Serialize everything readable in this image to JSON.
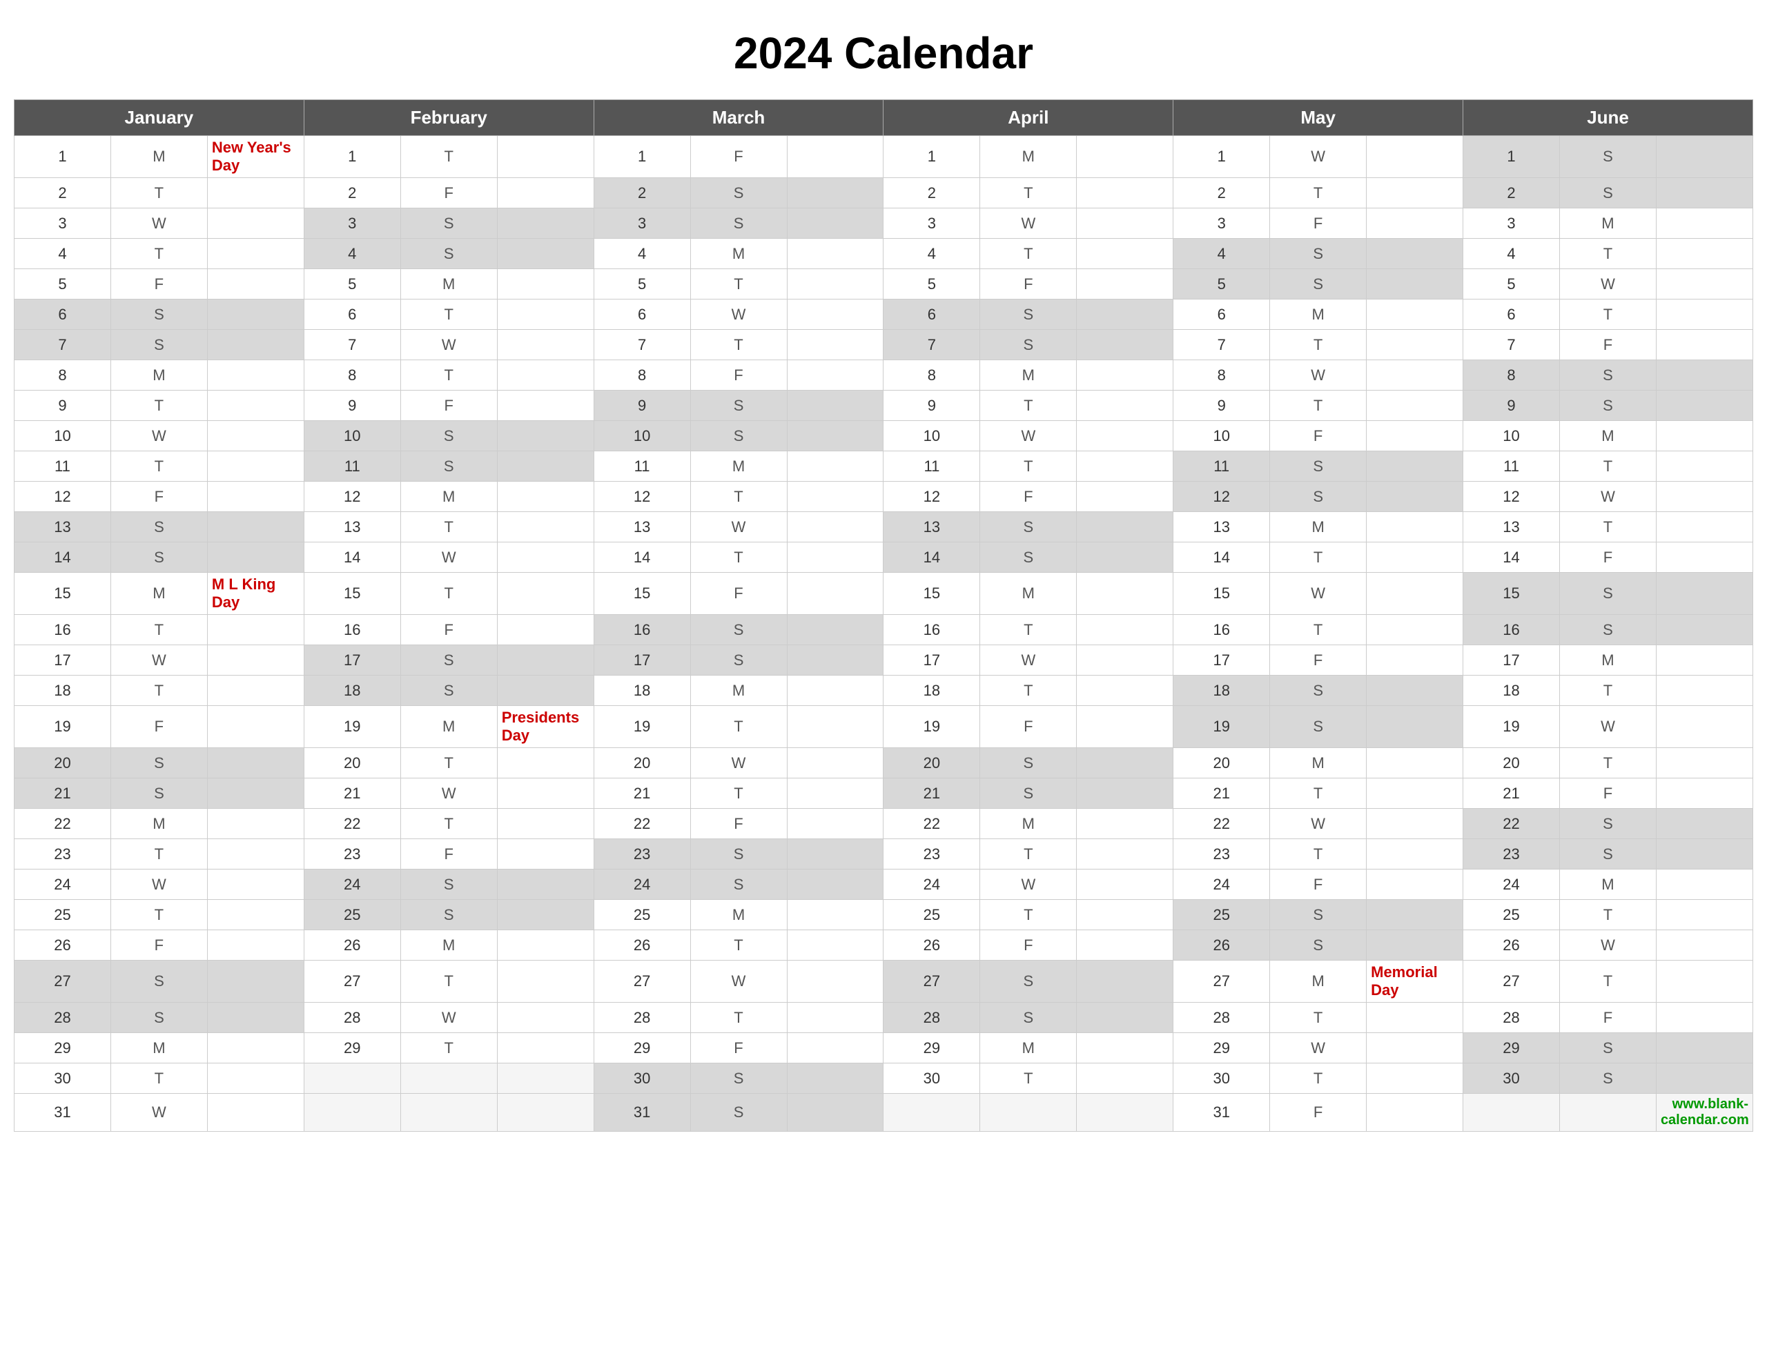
{
  "title": "2024 Calendar",
  "months": [
    "January",
    "February",
    "March",
    "April",
    "May",
    "June"
  ],
  "days": {
    "jan": [
      {
        "d": 1,
        "day": "M",
        "event": "New Year's Day",
        "weekend": false
      },
      {
        "d": 2,
        "day": "T",
        "event": "",
        "weekend": false
      },
      {
        "d": 3,
        "day": "W",
        "event": "",
        "weekend": false
      },
      {
        "d": 4,
        "day": "T",
        "event": "",
        "weekend": false
      },
      {
        "d": 5,
        "day": "F",
        "event": "",
        "weekend": false
      },
      {
        "d": 6,
        "day": "S",
        "event": "",
        "weekend": true
      },
      {
        "d": 7,
        "day": "S",
        "event": "",
        "weekend": true
      },
      {
        "d": 8,
        "day": "M",
        "event": "",
        "weekend": false
      },
      {
        "d": 9,
        "day": "T",
        "event": "",
        "weekend": false
      },
      {
        "d": 10,
        "day": "W",
        "event": "",
        "weekend": false
      },
      {
        "d": 11,
        "day": "T",
        "event": "",
        "weekend": false
      },
      {
        "d": 12,
        "day": "F",
        "event": "",
        "weekend": false
      },
      {
        "d": 13,
        "day": "S",
        "event": "",
        "weekend": true
      },
      {
        "d": 14,
        "day": "S",
        "event": "",
        "weekend": true
      },
      {
        "d": 15,
        "day": "M",
        "event": "M L King Day",
        "weekend": false
      },
      {
        "d": 16,
        "day": "T",
        "event": "",
        "weekend": false
      },
      {
        "d": 17,
        "day": "W",
        "event": "",
        "weekend": false
      },
      {
        "d": 18,
        "day": "T",
        "event": "",
        "weekend": false
      },
      {
        "d": 19,
        "day": "F",
        "event": "",
        "weekend": false
      },
      {
        "d": 20,
        "day": "S",
        "event": "",
        "weekend": true
      },
      {
        "d": 21,
        "day": "S",
        "event": "",
        "weekend": true
      },
      {
        "d": 22,
        "day": "M",
        "event": "",
        "weekend": false
      },
      {
        "d": 23,
        "day": "T",
        "event": "",
        "weekend": false
      },
      {
        "d": 24,
        "day": "W",
        "event": "",
        "weekend": false
      },
      {
        "d": 25,
        "day": "T",
        "event": "",
        "weekend": false
      },
      {
        "d": 26,
        "day": "F",
        "event": "",
        "weekend": false
      },
      {
        "d": 27,
        "day": "S",
        "event": "",
        "weekend": true
      },
      {
        "d": 28,
        "day": "S",
        "event": "",
        "weekend": true
      },
      {
        "d": 29,
        "day": "M",
        "event": "",
        "weekend": false
      },
      {
        "d": 30,
        "day": "T",
        "event": "",
        "weekend": false
      },
      {
        "d": 31,
        "day": "W",
        "event": "",
        "weekend": false
      }
    ],
    "feb": [
      {
        "d": 1,
        "day": "T",
        "event": "",
        "weekend": false
      },
      {
        "d": 2,
        "day": "F",
        "event": "",
        "weekend": false
      },
      {
        "d": 3,
        "day": "S",
        "event": "",
        "weekend": true
      },
      {
        "d": 4,
        "day": "S",
        "event": "",
        "weekend": true
      },
      {
        "d": 5,
        "day": "M",
        "event": "",
        "weekend": false
      },
      {
        "d": 6,
        "day": "T",
        "event": "",
        "weekend": false
      },
      {
        "d": 7,
        "day": "W",
        "event": "",
        "weekend": false
      },
      {
        "d": 8,
        "day": "T",
        "event": "",
        "weekend": false
      },
      {
        "d": 9,
        "day": "F",
        "event": "",
        "weekend": false
      },
      {
        "d": 10,
        "day": "S",
        "event": "",
        "weekend": true
      },
      {
        "d": 11,
        "day": "S",
        "event": "",
        "weekend": true
      },
      {
        "d": 12,
        "day": "M",
        "event": "",
        "weekend": false
      },
      {
        "d": 13,
        "day": "T",
        "event": "",
        "weekend": false
      },
      {
        "d": 14,
        "day": "W",
        "event": "",
        "weekend": false
      },
      {
        "d": 15,
        "day": "T",
        "event": "",
        "weekend": false
      },
      {
        "d": 16,
        "day": "F",
        "event": "",
        "weekend": false
      },
      {
        "d": 17,
        "day": "S",
        "event": "",
        "weekend": true
      },
      {
        "d": 18,
        "day": "S",
        "event": "",
        "weekend": true
      },
      {
        "d": 19,
        "day": "M",
        "event": "Presidents Day",
        "weekend": false
      },
      {
        "d": 20,
        "day": "T",
        "event": "",
        "weekend": false
      },
      {
        "d": 21,
        "day": "W",
        "event": "",
        "weekend": false
      },
      {
        "d": 22,
        "day": "T",
        "event": "",
        "weekend": false
      },
      {
        "d": 23,
        "day": "F",
        "event": "",
        "weekend": false
      },
      {
        "d": 24,
        "day": "S",
        "event": "",
        "weekend": true
      },
      {
        "d": 25,
        "day": "S",
        "event": "",
        "weekend": true
      },
      {
        "d": 26,
        "day": "M",
        "event": "",
        "weekend": false
      },
      {
        "d": 27,
        "day": "T",
        "event": "",
        "weekend": false
      },
      {
        "d": 28,
        "day": "W",
        "event": "",
        "weekend": false
      },
      {
        "d": 29,
        "day": "T",
        "event": "",
        "weekend": false
      }
    ],
    "mar": [
      {
        "d": 1,
        "day": "F",
        "event": "",
        "weekend": false
      },
      {
        "d": 2,
        "day": "S",
        "event": "",
        "weekend": true
      },
      {
        "d": 3,
        "day": "S",
        "event": "",
        "weekend": true
      },
      {
        "d": 4,
        "day": "M",
        "event": "",
        "weekend": false
      },
      {
        "d": 5,
        "day": "T",
        "event": "",
        "weekend": false
      },
      {
        "d": 6,
        "day": "W",
        "event": "",
        "weekend": false
      },
      {
        "d": 7,
        "day": "T",
        "event": "",
        "weekend": false
      },
      {
        "d": 8,
        "day": "F",
        "event": "",
        "weekend": false
      },
      {
        "d": 9,
        "day": "S",
        "event": "",
        "weekend": true
      },
      {
        "d": 10,
        "day": "S",
        "event": "",
        "weekend": true
      },
      {
        "d": 11,
        "day": "M",
        "event": "",
        "weekend": false
      },
      {
        "d": 12,
        "day": "T",
        "event": "",
        "weekend": false
      },
      {
        "d": 13,
        "day": "W",
        "event": "",
        "weekend": false
      },
      {
        "d": 14,
        "day": "T",
        "event": "",
        "weekend": false
      },
      {
        "d": 15,
        "day": "F",
        "event": "",
        "weekend": false
      },
      {
        "d": 16,
        "day": "S",
        "event": "",
        "weekend": true
      },
      {
        "d": 17,
        "day": "S",
        "event": "",
        "weekend": true
      },
      {
        "d": 18,
        "day": "M",
        "event": "",
        "weekend": false
      },
      {
        "d": 19,
        "day": "T",
        "event": "",
        "weekend": false
      },
      {
        "d": 20,
        "day": "W",
        "event": "",
        "weekend": false
      },
      {
        "d": 21,
        "day": "T",
        "event": "",
        "weekend": false
      },
      {
        "d": 22,
        "day": "F",
        "event": "",
        "weekend": false
      },
      {
        "d": 23,
        "day": "S",
        "event": "",
        "weekend": true
      },
      {
        "d": 24,
        "day": "S",
        "event": "",
        "weekend": true
      },
      {
        "d": 25,
        "day": "M",
        "event": "",
        "weekend": false
      },
      {
        "d": 26,
        "day": "T",
        "event": "",
        "weekend": false
      },
      {
        "d": 27,
        "day": "W",
        "event": "",
        "weekend": false
      },
      {
        "d": 28,
        "day": "T",
        "event": "",
        "weekend": false
      },
      {
        "d": 29,
        "day": "F",
        "event": "",
        "weekend": false
      },
      {
        "d": 30,
        "day": "S",
        "event": "",
        "weekend": true
      },
      {
        "d": 31,
        "day": "S",
        "event": "",
        "weekend": true
      }
    ],
    "apr": [
      {
        "d": 1,
        "day": "M",
        "event": "",
        "weekend": false
      },
      {
        "d": 2,
        "day": "T",
        "event": "",
        "weekend": false
      },
      {
        "d": 3,
        "day": "W",
        "event": "",
        "weekend": false
      },
      {
        "d": 4,
        "day": "T",
        "event": "",
        "weekend": false
      },
      {
        "d": 5,
        "day": "F",
        "event": "",
        "weekend": false
      },
      {
        "d": 6,
        "day": "S",
        "event": "",
        "weekend": true
      },
      {
        "d": 7,
        "day": "S",
        "event": "",
        "weekend": true
      },
      {
        "d": 8,
        "day": "M",
        "event": "",
        "weekend": false
      },
      {
        "d": 9,
        "day": "T",
        "event": "",
        "weekend": false
      },
      {
        "d": 10,
        "day": "W",
        "event": "",
        "weekend": false
      },
      {
        "d": 11,
        "day": "T",
        "event": "",
        "weekend": false
      },
      {
        "d": 12,
        "day": "F",
        "event": "",
        "weekend": false
      },
      {
        "d": 13,
        "day": "S",
        "event": "",
        "weekend": true
      },
      {
        "d": 14,
        "day": "S",
        "event": "",
        "weekend": true
      },
      {
        "d": 15,
        "day": "M",
        "event": "",
        "weekend": false
      },
      {
        "d": 16,
        "day": "T",
        "event": "",
        "weekend": false
      },
      {
        "d": 17,
        "day": "W",
        "event": "",
        "weekend": false
      },
      {
        "d": 18,
        "day": "T",
        "event": "",
        "weekend": false
      },
      {
        "d": 19,
        "day": "F",
        "event": "",
        "weekend": false
      },
      {
        "d": 20,
        "day": "S",
        "event": "",
        "weekend": true
      },
      {
        "d": 21,
        "day": "S",
        "event": "",
        "weekend": true
      },
      {
        "d": 22,
        "day": "M",
        "event": "",
        "weekend": false
      },
      {
        "d": 23,
        "day": "T",
        "event": "",
        "weekend": false
      },
      {
        "d": 24,
        "day": "W",
        "event": "",
        "weekend": false
      },
      {
        "d": 25,
        "day": "T",
        "event": "",
        "weekend": false
      },
      {
        "d": 26,
        "day": "F",
        "event": "",
        "weekend": false
      },
      {
        "d": 27,
        "day": "S",
        "event": "",
        "weekend": true
      },
      {
        "d": 28,
        "day": "S",
        "event": "",
        "weekend": true
      },
      {
        "d": 29,
        "day": "M",
        "event": "",
        "weekend": false
      },
      {
        "d": 30,
        "day": "T",
        "event": "",
        "weekend": false
      }
    ],
    "may": [
      {
        "d": 1,
        "day": "W",
        "event": "",
        "weekend": false
      },
      {
        "d": 2,
        "day": "T",
        "event": "",
        "weekend": false
      },
      {
        "d": 3,
        "day": "F",
        "event": "",
        "weekend": false
      },
      {
        "d": 4,
        "day": "S",
        "event": "",
        "weekend": true
      },
      {
        "d": 5,
        "day": "S",
        "event": "",
        "weekend": true
      },
      {
        "d": 6,
        "day": "M",
        "event": "",
        "weekend": false
      },
      {
        "d": 7,
        "day": "T",
        "event": "",
        "weekend": false
      },
      {
        "d": 8,
        "day": "W",
        "event": "",
        "weekend": false
      },
      {
        "d": 9,
        "day": "T",
        "event": "",
        "weekend": false
      },
      {
        "d": 10,
        "day": "F",
        "event": "",
        "weekend": false
      },
      {
        "d": 11,
        "day": "S",
        "event": "",
        "weekend": true
      },
      {
        "d": 12,
        "day": "S",
        "event": "",
        "weekend": true
      },
      {
        "d": 13,
        "day": "M",
        "event": "",
        "weekend": false
      },
      {
        "d": 14,
        "day": "T",
        "event": "",
        "weekend": false
      },
      {
        "d": 15,
        "day": "W",
        "event": "",
        "weekend": false
      },
      {
        "d": 16,
        "day": "T",
        "event": "",
        "weekend": false
      },
      {
        "d": 17,
        "day": "F",
        "event": "",
        "weekend": false
      },
      {
        "d": 18,
        "day": "S",
        "event": "",
        "weekend": true
      },
      {
        "d": 19,
        "day": "S",
        "event": "",
        "weekend": true
      },
      {
        "d": 20,
        "day": "M",
        "event": "",
        "weekend": false
      },
      {
        "d": 21,
        "day": "T",
        "event": "",
        "weekend": false
      },
      {
        "d": 22,
        "day": "W",
        "event": "",
        "weekend": false
      },
      {
        "d": 23,
        "day": "T",
        "event": "",
        "weekend": false
      },
      {
        "d": 24,
        "day": "F",
        "event": "",
        "weekend": false
      },
      {
        "d": 25,
        "day": "S",
        "event": "",
        "weekend": true
      },
      {
        "d": 26,
        "day": "S",
        "event": "",
        "weekend": true
      },
      {
        "d": 27,
        "day": "M",
        "event": "Memorial Day",
        "weekend": false
      },
      {
        "d": 28,
        "day": "T",
        "event": "",
        "weekend": false
      },
      {
        "d": 29,
        "day": "W",
        "event": "",
        "weekend": false
      },
      {
        "d": 30,
        "day": "T",
        "event": "",
        "weekend": false
      },
      {
        "d": 31,
        "day": "F",
        "event": "",
        "weekend": false
      }
    ],
    "jun": [
      {
        "d": 1,
        "day": "S",
        "event": "",
        "weekend": true
      },
      {
        "d": 2,
        "day": "S",
        "event": "",
        "weekend": true
      },
      {
        "d": 3,
        "day": "M",
        "event": "",
        "weekend": false
      },
      {
        "d": 4,
        "day": "T",
        "event": "",
        "weekend": false
      },
      {
        "d": 5,
        "day": "W",
        "event": "",
        "weekend": false
      },
      {
        "d": 6,
        "day": "T",
        "event": "",
        "weekend": false
      },
      {
        "d": 7,
        "day": "F",
        "event": "",
        "weekend": false
      },
      {
        "d": 8,
        "day": "S",
        "event": "",
        "weekend": true
      },
      {
        "d": 9,
        "day": "S",
        "event": "",
        "weekend": true
      },
      {
        "d": 10,
        "day": "M",
        "event": "",
        "weekend": false
      },
      {
        "d": 11,
        "day": "T",
        "event": "",
        "weekend": false
      },
      {
        "d": 12,
        "day": "W",
        "event": "",
        "weekend": false
      },
      {
        "d": 13,
        "day": "T",
        "event": "",
        "weekend": false
      },
      {
        "d": 14,
        "day": "F",
        "event": "",
        "weekend": false
      },
      {
        "d": 15,
        "day": "S",
        "event": "",
        "weekend": true
      },
      {
        "d": 16,
        "day": "S",
        "event": "",
        "weekend": true
      },
      {
        "d": 17,
        "day": "M",
        "event": "",
        "weekend": false
      },
      {
        "d": 18,
        "day": "T",
        "event": "",
        "weekend": false
      },
      {
        "d": 19,
        "day": "W",
        "event": "",
        "weekend": false
      },
      {
        "d": 20,
        "day": "T",
        "event": "",
        "weekend": false
      },
      {
        "d": 21,
        "day": "F",
        "event": "",
        "weekend": false
      },
      {
        "d": 22,
        "day": "S",
        "event": "",
        "weekend": true
      },
      {
        "d": 23,
        "day": "S",
        "event": "",
        "weekend": true
      },
      {
        "d": 24,
        "day": "M",
        "event": "",
        "weekend": false
      },
      {
        "d": 25,
        "day": "T",
        "event": "",
        "weekend": false
      },
      {
        "d": 26,
        "day": "W",
        "event": "",
        "weekend": false
      },
      {
        "d": 27,
        "day": "T",
        "event": "",
        "weekend": false
      },
      {
        "d": 28,
        "day": "F",
        "event": "",
        "weekend": false
      },
      {
        "d": 29,
        "day": "S",
        "event": "",
        "weekend": true
      },
      {
        "d": 30,
        "day": "S",
        "event": "",
        "weekend": true
      }
    ]
  },
  "footer": "www.blank-calendar.com"
}
